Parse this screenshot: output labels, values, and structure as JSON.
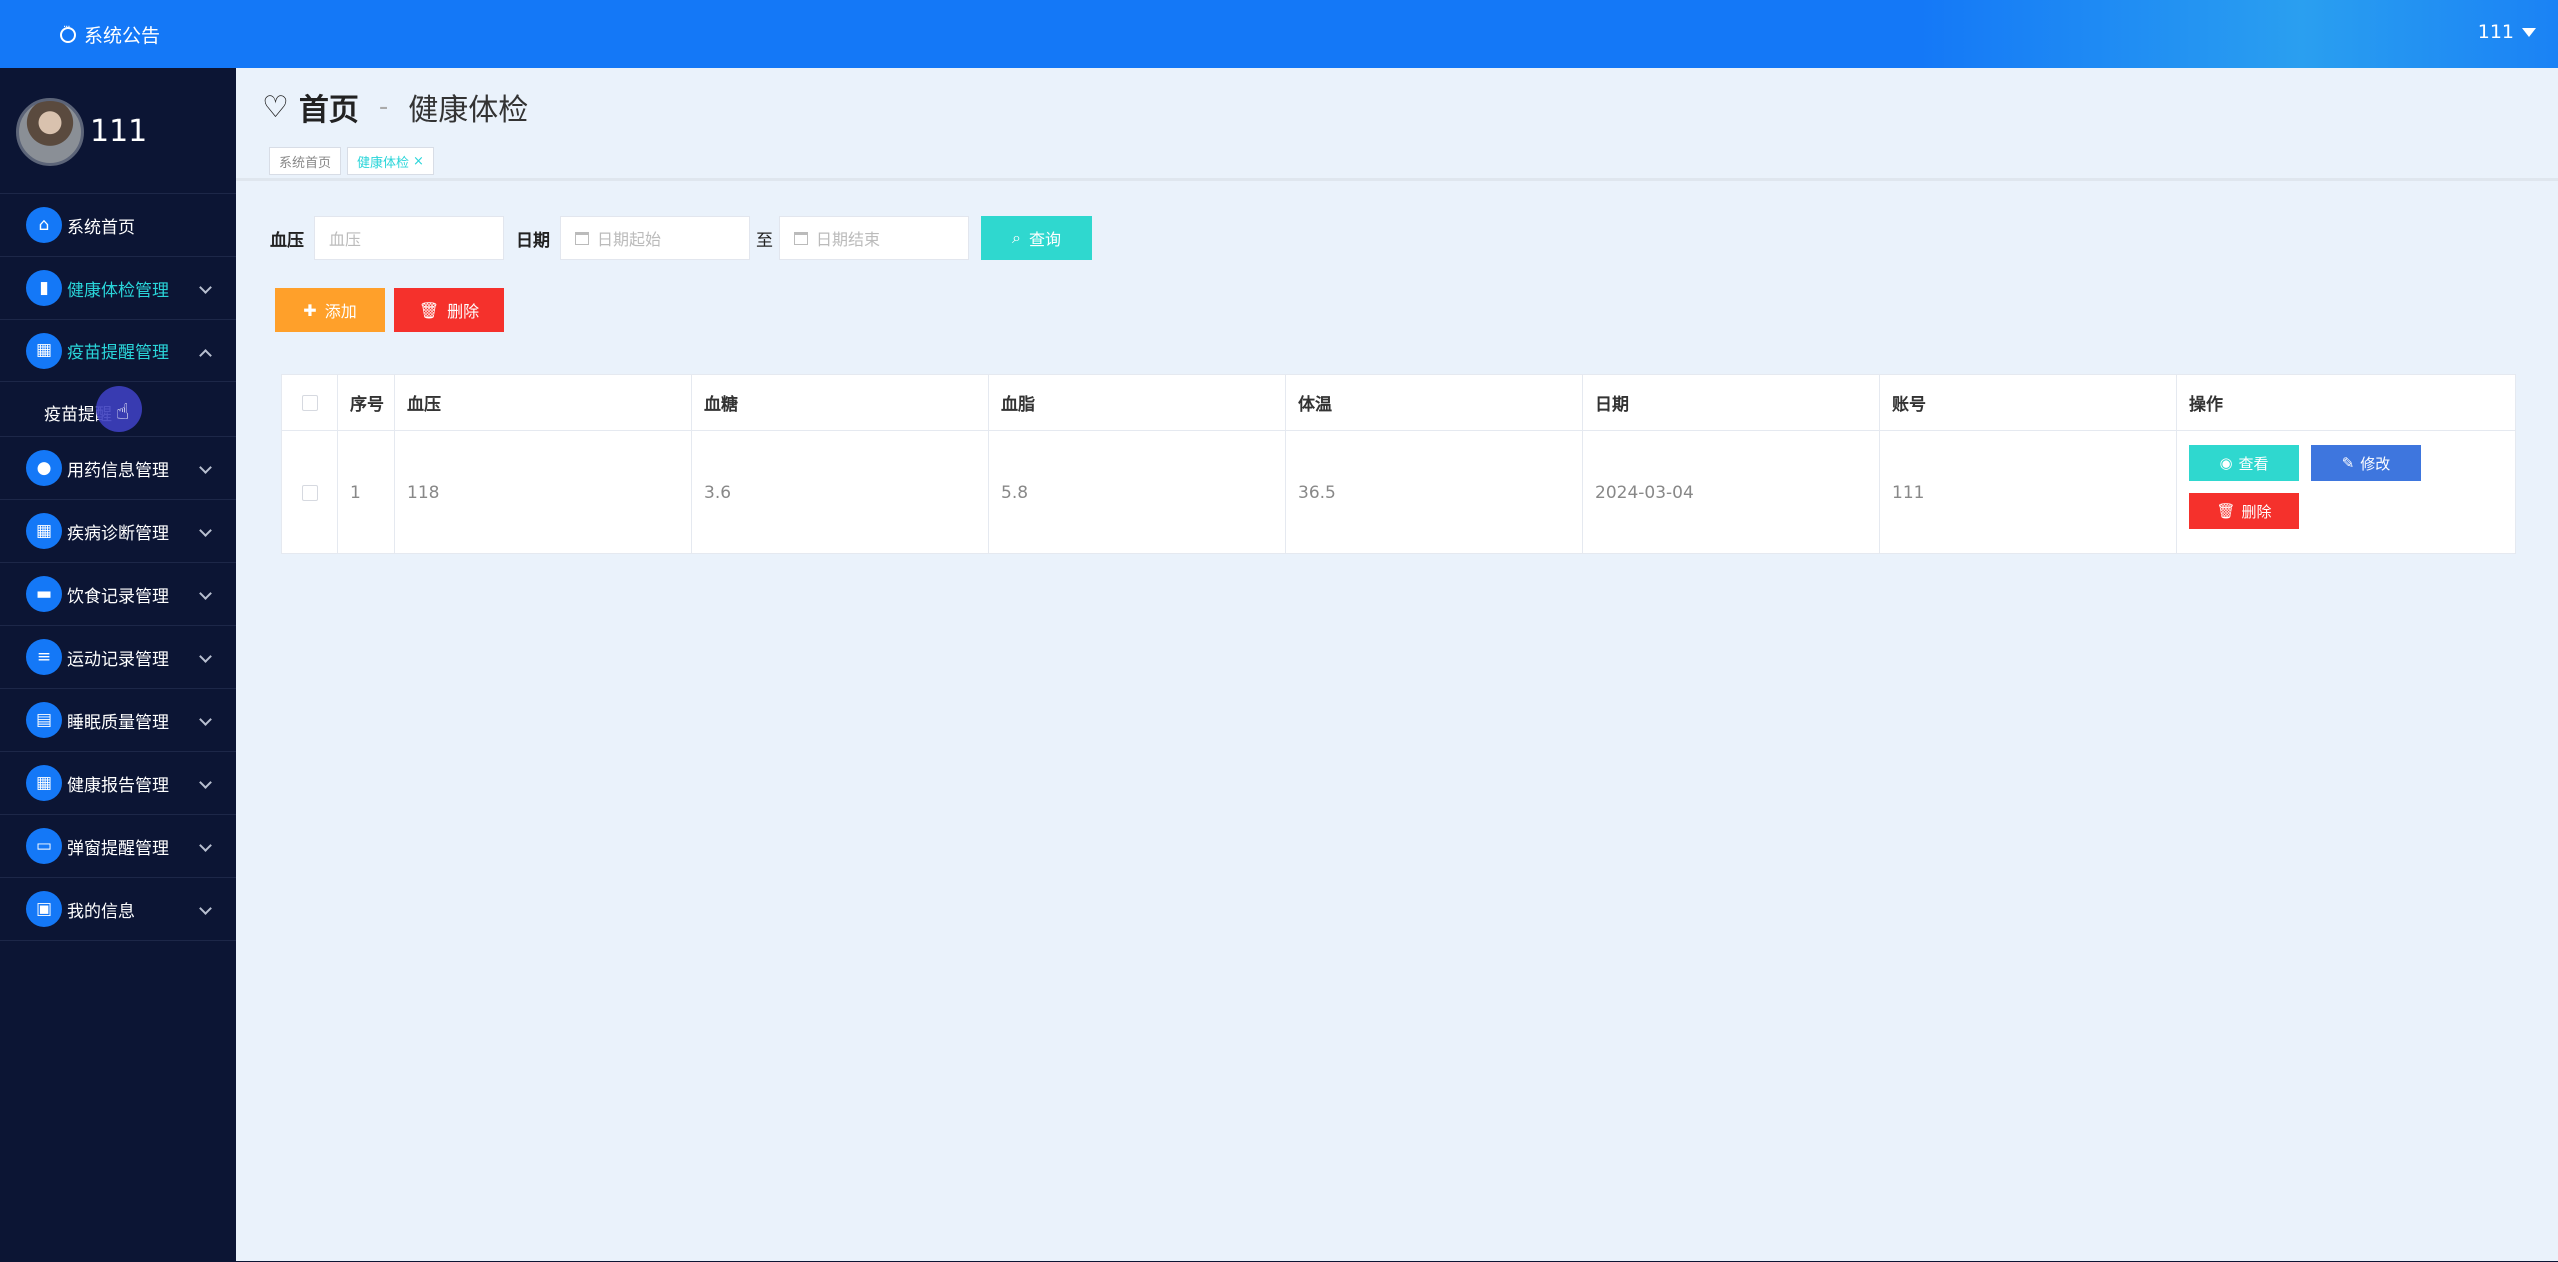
{
  "topbar": {
    "notice": "系统公告",
    "user": "111"
  },
  "sidebar": {
    "username": "111",
    "items": [
      {
        "label": "系统首页",
        "icon": "home-icon",
        "glyph": "⌂",
        "expand": "none"
      },
      {
        "label": "健康体检管理",
        "icon": "bar-chart-icon",
        "glyph": "▮",
        "expand": "down"
      },
      {
        "label": "疫苗提醒管理",
        "icon": "grid-icon",
        "glyph": "▦",
        "expand": "up"
      },
      {
        "label": "用药信息管理",
        "icon": "location-pin-icon",
        "glyph": "●",
        "expand": "down"
      },
      {
        "label": "疾病诊断管理",
        "icon": "grid-icon",
        "glyph": "▦",
        "expand": "down"
      },
      {
        "label": "饮食记录管理",
        "icon": "briefcase-icon",
        "glyph": "▬",
        "expand": "down"
      },
      {
        "label": "运动记录管理",
        "icon": "sliders-icon",
        "glyph": "≡",
        "expand": "down"
      },
      {
        "label": "睡眠质量管理",
        "icon": "clipboard-icon",
        "glyph": "▤",
        "expand": "down"
      },
      {
        "label": "健康报告管理",
        "icon": "grid-icon",
        "glyph": "▦",
        "expand": "down"
      },
      {
        "label": "弹窗提醒管理",
        "icon": "monitor-icon",
        "glyph": "▭",
        "expand": "down"
      },
      {
        "label": "我的信息",
        "icon": "card-icon",
        "glyph": "▣",
        "expand": "down"
      }
    ],
    "sub_item": "疫苗提醒"
  },
  "header": {
    "home": "首页",
    "separator": "-",
    "current": "健康体检"
  },
  "tabs": [
    {
      "label": "系统首页"
    },
    {
      "label": "健康体检"
    }
  ],
  "search": {
    "bp_label": "血压",
    "bp_placeholder": "血压",
    "date_label": "日期",
    "start_placeholder": "日期起始",
    "to_label": "至",
    "end_placeholder": "日期结束",
    "query": "查询"
  },
  "actions": {
    "add": "添加",
    "delete": "删除"
  },
  "table": {
    "headers": [
      "序号",
      "血压",
      "血糖",
      "血脂",
      "体温",
      "日期",
      "账号",
      "操作"
    ],
    "rows": [
      {
        "index": "1",
        "bp": "118",
        "sugar": "3.6",
        "lipid": "5.8",
        "temp": "36.5",
        "date": "2024-03-04",
        "account": "111"
      }
    ],
    "ops": {
      "view": "查看",
      "edit": "修改",
      "delete": "删除"
    }
  },
  "colors": {
    "primary": "#1478f7",
    "sidebar": "#0c1534",
    "cyan": "#2fd8cf",
    "orange": "#ffa02a",
    "red": "#f5312c",
    "blue": "#3e76de"
  }
}
